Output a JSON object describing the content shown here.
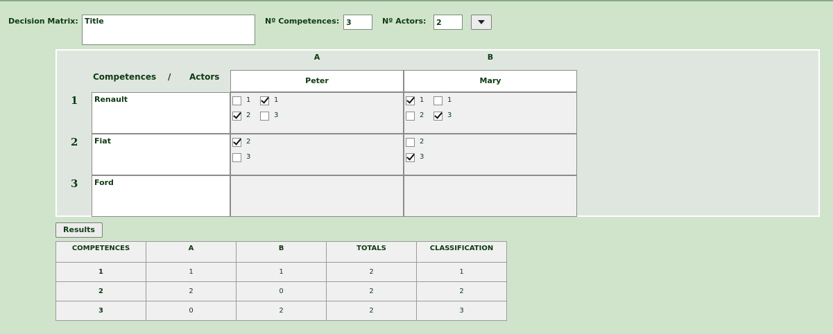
{
  "header": {
    "decision_matrix_label": "Decision Matrix:",
    "title_value": "Title",
    "competences_label": "Nº Competences:",
    "competences_value": "3",
    "actors_label": "Nº Actors:",
    "actors_value": "2"
  },
  "matrix": {
    "corner": {
      "competences": "Competences",
      "slash": "/",
      "actors": "Actors"
    },
    "columns": [
      {
        "letter": "A",
        "actor": "Peter"
      },
      {
        "letter": "B",
        "actor": "Mary"
      }
    ],
    "rows": [
      {
        "num": "1",
        "name": "Renault"
      },
      {
        "num": "2",
        "name": "Fiat"
      },
      {
        "num": "3",
        "name": "Ford"
      }
    ],
    "checkboxes": [
      {
        "row": 1,
        "col": "A",
        "label": "1",
        "checked": false
      },
      {
        "row": 1,
        "col": "A",
        "label": "1",
        "checked": true
      },
      {
        "row": 1,
        "col": "A",
        "label": "2",
        "checked": true
      },
      {
        "row": 1,
        "col": "A",
        "label": "3",
        "checked": false
      },
      {
        "row": 1,
        "col": "B",
        "label": "1",
        "checked": true
      },
      {
        "row": 1,
        "col": "B",
        "label": "1",
        "checked": false
      },
      {
        "row": 1,
        "col": "B",
        "label": "2",
        "checked": false
      },
      {
        "row": 1,
        "col": "B",
        "label": "3",
        "checked": true
      },
      {
        "row": 2,
        "col": "A",
        "label": "2",
        "checked": true
      },
      {
        "row": 2,
        "col": "A",
        "label": "3",
        "checked": false
      },
      {
        "row": 2,
        "col": "B",
        "label": "2",
        "checked": false
      },
      {
        "row": 2,
        "col": "B",
        "label": "3",
        "checked": true
      }
    ]
  },
  "results_button": "Results",
  "results": {
    "headers": [
      "COMPETENCES",
      "A",
      "B",
      "TOTALS",
      "CLASSIFICATION"
    ],
    "rows": [
      [
        "1",
        "1",
        "1",
        "2",
        "1"
      ],
      [
        "2",
        "2",
        "0",
        "2",
        "2"
      ],
      [
        "3",
        "0",
        "2",
        "2",
        "3"
      ]
    ]
  },
  "colors": {
    "background": "#d0e4cb",
    "text": "#0e3a10",
    "panel": "#dfe6e0"
  },
  "icons": {
    "dropdown": "chevron-down-icon",
    "check": "check-icon"
  }
}
